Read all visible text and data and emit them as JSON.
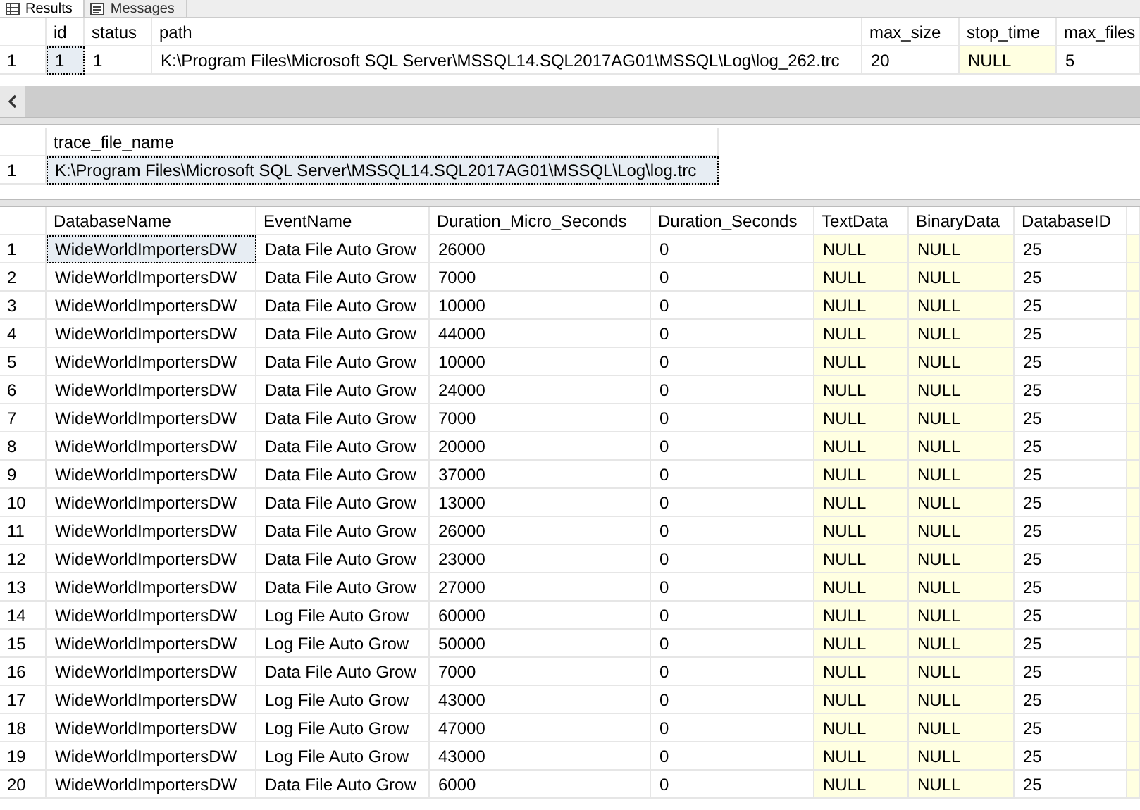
{
  "tabs": [
    {
      "label": "Results",
      "kind": "grid",
      "selected": true
    },
    {
      "label": "Messages",
      "kind": "messages",
      "selected": false
    }
  ],
  "grids": [
    {
      "scrollbar": true,
      "columns": [
        {
          "name": "id",
          "all_null": false
        },
        {
          "name": "status",
          "all_null": false
        },
        {
          "name": "path",
          "all_null": false
        },
        {
          "name": "max_size",
          "all_null": false
        },
        {
          "name": "stop_time",
          "all_null": true
        },
        {
          "name": "max_files",
          "all_null": false
        }
      ],
      "rows": [
        {
          "number": "1",
          "selected": true,
          "cells": [
            "1",
            "1",
            "K:\\Program Files\\Microsoft SQL Server\\MSSQL14.SQL2017AG01\\MSSQL\\Log\\log_262.trc",
            "20",
            "NULL",
            "5"
          ]
        }
      ]
    },
    {
      "scrollbar": false,
      "columns": [
        {
          "name": "trace_file_name",
          "all_null": false
        }
      ],
      "rows": [
        {
          "number": "1",
          "selected": true,
          "cells": [
            "K:\\Program Files\\Microsoft SQL Server\\MSSQL14.SQL2017AG01\\MSSQL\\Log\\log.trc"
          ]
        }
      ]
    },
    {
      "scrollbar": false,
      "columns": [
        {
          "name": "DatabaseName",
          "all_null": false
        },
        {
          "name": "EventName",
          "all_null": false
        },
        {
          "name": "Duration_Micro_Seconds",
          "all_null": false
        },
        {
          "name": "Duration_Seconds",
          "all_null": false
        },
        {
          "name": "TextData",
          "all_null": true
        },
        {
          "name": "BinaryData",
          "all_null": true
        },
        {
          "name": "DatabaseID",
          "all_null": false
        }
      ],
      "rows": [
        {
          "number": "1",
          "selected": true,
          "cells": [
            "WideWorldImportersDW",
            "Data File Auto Grow",
            "26000",
            "0",
            "NULL",
            "NULL",
            "25"
          ]
        },
        {
          "number": "2",
          "selected": false,
          "cells": [
            "WideWorldImportersDW",
            "Data File Auto Grow",
            "7000",
            "0",
            "NULL",
            "NULL",
            "25"
          ]
        },
        {
          "number": "3",
          "selected": false,
          "cells": [
            "WideWorldImportersDW",
            "Data File Auto Grow",
            "10000",
            "0",
            "NULL",
            "NULL",
            "25"
          ]
        },
        {
          "number": "4",
          "selected": false,
          "cells": [
            "WideWorldImportersDW",
            "Data File Auto Grow",
            "44000",
            "0",
            "NULL",
            "NULL",
            "25"
          ]
        },
        {
          "number": "5",
          "selected": false,
          "cells": [
            "WideWorldImportersDW",
            "Data File Auto Grow",
            "10000",
            "0",
            "NULL",
            "NULL",
            "25"
          ]
        },
        {
          "number": "6",
          "selected": false,
          "cells": [
            "WideWorldImportersDW",
            "Data File Auto Grow",
            "24000",
            "0",
            "NULL",
            "NULL",
            "25"
          ]
        },
        {
          "number": "7",
          "selected": false,
          "cells": [
            "WideWorldImportersDW",
            "Data File Auto Grow",
            "7000",
            "0",
            "NULL",
            "NULL",
            "25"
          ]
        },
        {
          "number": "8",
          "selected": false,
          "cells": [
            "WideWorldImportersDW",
            "Data File Auto Grow",
            "20000",
            "0",
            "NULL",
            "NULL",
            "25"
          ]
        },
        {
          "number": "9",
          "selected": false,
          "cells": [
            "WideWorldImportersDW",
            "Data File Auto Grow",
            "37000",
            "0",
            "NULL",
            "NULL",
            "25"
          ]
        },
        {
          "number": "10",
          "selected": false,
          "cells": [
            "WideWorldImportersDW",
            "Data File Auto Grow",
            "13000",
            "0",
            "NULL",
            "NULL",
            "25"
          ]
        },
        {
          "number": "11",
          "selected": false,
          "cells": [
            "WideWorldImportersDW",
            "Data File Auto Grow",
            "26000",
            "0",
            "NULL",
            "NULL",
            "25"
          ]
        },
        {
          "number": "12",
          "selected": false,
          "cells": [
            "WideWorldImportersDW",
            "Data File Auto Grow",
            "23000",
            "0",
            "NULL",
            "NULL",
            "25"
          ]
        },
        {
          "number": "13",
          "selected": false,
          "cells": [
            "WideWorldImportersDW",
            "Data File Auto Grow",
            "27000",
            "0",
            "NULL",
            "NULL",
            "25"
          ]
        },
        {
          "number": "14",
          "selected": false,
          "cells": [
            "WideWorldImportersDW",
            "Log File Auto Grow",
            "60000",
            "0",
            "NULL",
            "NULL",
            "25"
          ]
        },
        {
          "number": "15",
          "selected": false,
          "cells": [
            "WideWorldImportersDW",
            "Log File Auto Grow",
            "50000",
            "0",
            "NULL",
            "NULL",
            "25"
          ]
        },
        {
          "number": "16",
          "selected": false,
          "cells": [
            "WideWorldImportersDW",
            "Data File Auto Grow",
            "7000",
            "0",
            "NULL",
            "NULL",
            "25"
          ]
        },
        {
          "number": "17",
          "selected": false,
          "cells": [
            "WideWorldImportersDW",
            "Log File Auto Grow",
            "43000",
            "0",
            "NULL",
            "NULL",
            "25"
          ]
        },
        {
          "number": "18",
          "selected": false,
          "cells": [
            "WideWorldImportersDW",
            "Log File Auto Grow",
            "47000",
            "0",
            "NULL",
            "NULL",
            "25"
          ]
        },
        {
          "number": "19",
          "selected": false,
          "cells": [
            "WideWorldImportersDW",
            "Log File Auto Grow",
            "43000",
            "0",
            "NULL",
            "NULL",
            "25"
          ]
        },
        {
          "number": "20",
          "selected": false,
          "cells": [
            "WideWorldImportersDW",
            "Data File Auto Grow",
            "6000",
            "0",
            "NULL",
            "NULL",
            "25"
          ]
        }
      ]
    }
  ]
}
